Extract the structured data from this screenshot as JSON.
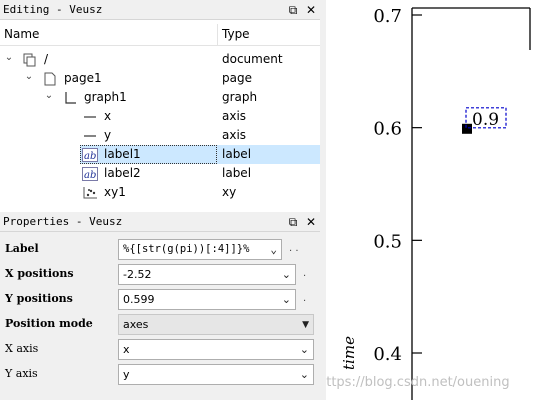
{
  "editing": {
    "title": "Editing - Veusz",
    "col_name": "Name",
    "col_type": "Type",
    "rows": [
      {
        "name": "/",
        "type": "document",
        "icon": "document-icon"
      },
      {
        "name": "page1",
        "type": "page",
        "icon": "page-icon"
      },
      {
        "name": "graph1",
        "type": "graph",
        "icon": "graph-icon"
      },
      {
        "name": "x",
        "type": "axis",
        "icon": "axis-icon"
      },
      {
        "name": "y",
        "type": "axis",
        "icon": "axis-icon"
      },
      {
        "name": "label1",
        "type": "label",
        "icon": "label-icon"
      },
      {
        "name": "label2",
        "type": "label",
        "icon": "label-icon"
      },
      {
        "name": "xy1",
        "type": "xy",
        "icon": "xy-icon"
      }
    ]
  },
  "properties": {
    "title": "Properties - Veusz",
    "rows": [
      {
        "label": "Label",
        "value": "%{[str(g(pi))[:4]]}%"
      },
      {
        "label": "X positions",
        "value": "-2.52"
      },
      {
        "label": "Y positions",
        "value": "0.599"
      },
      {
        "label": "Position mode",
        "value": "axes"
      },
      {
        "label": "X axis",
        "value": "x"
      },
      {
        "label": "Y axis",
        "value": "y"
      }
    ]
  },
  "chart_data": {
    "type": "scatter",
    "x": [
      -2.52
    ],
    "y": [
      0.599
    ],
    "ylabel": "time",
    "yticks": [
      "0.4",
      "0.5",
      "0.6",
      "0.7"
    ],
    "ylim": [
      0.37,
      0.715
    ],
    "point_label": "0.9"
  },
  "watermark": "https://blog.csdn.net/ouening",
  "colors": {
    "selection": "#cce8ff",
    "label_box": "#0000cc",
    "window_bg": "#f0f0f0"
  }
}
